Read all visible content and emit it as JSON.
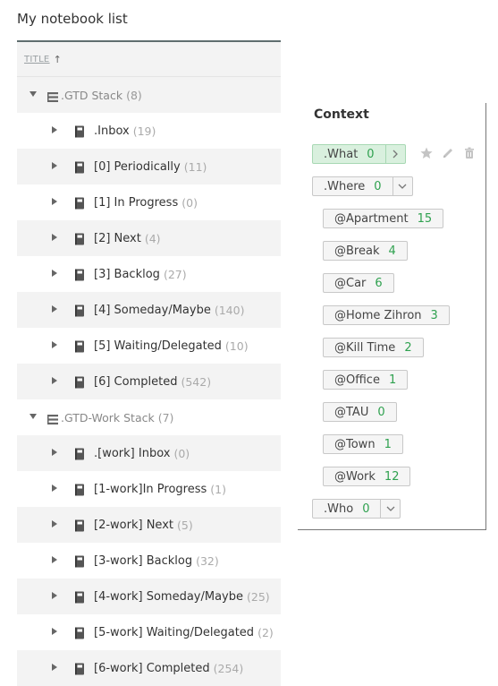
{
  "notebook_list": {
    "title": "My notebook list",
    "column_header": "TITLE",
    "sort_indicator": "↑",
    "rows": [
      {
        "type": "stack",
        "name": ".GTD Stack",
        "count": "(8)"
      },
      {
        "type": "notebook",
        "name": ".Inbox",
        "count": "(19)"
      },
      {
        "type": "notebook",
        "name": "[0] Periodically",
        "count": "(11)"
      },
      {
        "type": "notebook",
        "name": "[1] In Progress",
        "count": "(0)"
      },
      {
        "type": "notebook",
        "name": "[2] Next",
        "count": "(4)"
      },
      {
        "type": "notebook",
        "name": "[3] Backlog",
        "count": "(27)"
      },
      {
        "type": "notebook",
        "name": "[4] Someday/Maybe",
        "count": "(140)"
      },
      {
        "type": "notebook",
        "name": "[5] Waiting/Delegated",
        "count": "(10)"
      },
      {
        "type": "notebook",
        "name": "[6] Completed",
        "count": "(542)"
      },
      {
        "type": "stack",
        "name": ".GTD-Work Stack",
        "count": "(7)"
      },
      {
        "type": "notebook",
        "name": ".[work] Inbox",
        "count": "(0)"
      },
      {
        "type": "notebook",
        "name": "[1-work]In Progress",
        "count": "(1)"
      },
      {
        "type": "notebook",
        "name": "[2-work] Next",
        "count": "(5)"
      },
      {
        "type": "notebook",
        "name": "[3-work] Backlog",
        "count": "(32)"
      },
      {
        "type": "notebook",
        "name": "[4-work] Someday/Maybe",
        "count": "(25)"
      },
      {
        "type": "notebook",
        "name": "[5-work] Waiting/Delegated",
        "count": "(2)"
      },
      {
        "type": "notebook",
        "name": "[6-work] Completed",
        "count": "(254)"
      }
    ]
  },
  "context": {
    "title": "Context",
    "what": {
      "label": ".What",
      "count": "0",
      "chevron": "›"
    },
    "where": {
      "label": ".Where",
      "count": "0",
      "chevron": "⌄"
    },
    "where_tags": [
      {
        "label": "@Apartment",
        "count": "15"
      },
      {
        "label": "@Break",
        "count": "4"
      },
      {
        "label": "@Car",
        "count": "6"
      },
      {
        "label": "@Home Zihron",
        "count": "3"
      },
      {
        "label": "@Kill Time",
        "count": "2"
      },
      {
        "label": "@Office",
        "count": "1"
      },
      {
        "label": "@TAU",
        "count": "0"
      },
      {
        "label": "@Town",
        "count": "1"
      },
      {
        "label": "@Work",
        "count": "12"
      }
    ],
    "who": {
      "label": ".Who",
      "count": "0",
      "chevron": "⌄"
    },
    "actions": [
      "star-icon",
      "pencil-icon",
      "trash-icon"
    ]
  },
  "colors": {
    "count_green": "#2fa14f",
    "what_tag_bg": "#d9f0de",
    "row_shade": "#f3f3f3"
  }
}
